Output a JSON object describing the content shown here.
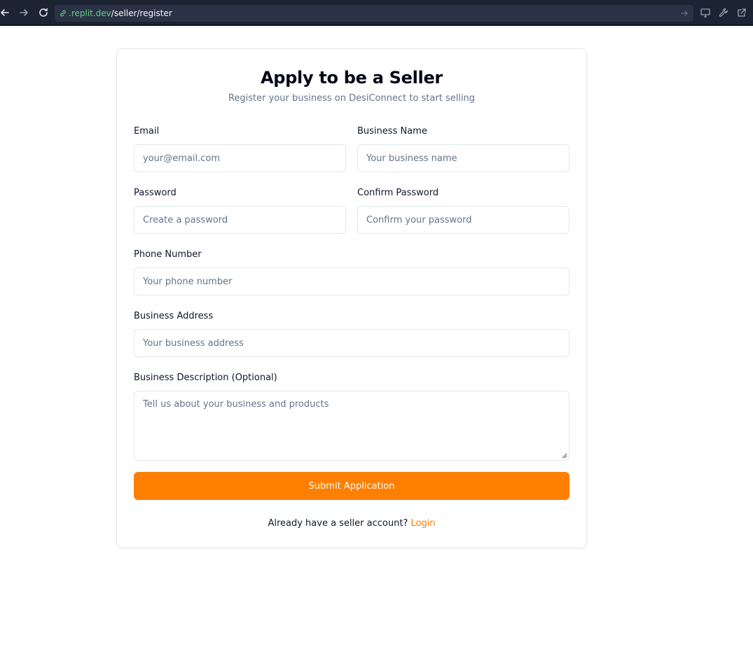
{
  "browser": {
    "url_host": ".replit.dev",
    "url_path": "/seller/register"
  },
  "form": {
    "title": "Apply to be a Seller",
    "subtitle": "Register your business on DesiConnect to start selling",
    "fields": {
      "email": {
        "label": "Email",
        "placeholder": "your@email.com",
        "value": ""
      },
      "business_name": {
        "label": "Business Name",
        "placeholder": "Your business name",
        "value": ""
      },
      "password": {
        "label": "Password",
        "placeholder": "Create a password",
        "value": ""
      },
      "confirm_password": {
        "label": "Confirm Password",
        "placeholder": "Confirm your password",
        "value": ""
      },
      "phone": {
        "label": "Phone Number",
        "placeholder": "Your phone number",
        "value": ""
      },
      "address": {
        "label": "Business Address",
        "placeholder": "Your business address",
        "value": ""
      },
      "description": {
        "label": "Business Description (Optional)",
        "placeholder": "Tell us about your business and products",
        "value": ""
      }
    },
    "submit_label": "Submit Application",
    "footer_text": "Already have a seller account?",
    "login_link": "Login"
  },
  "colors": {
    "accent": "#ff7f00",
    "browser_bg": "#1c2333",
    "url_host": "#5fcf80"
  }
}
